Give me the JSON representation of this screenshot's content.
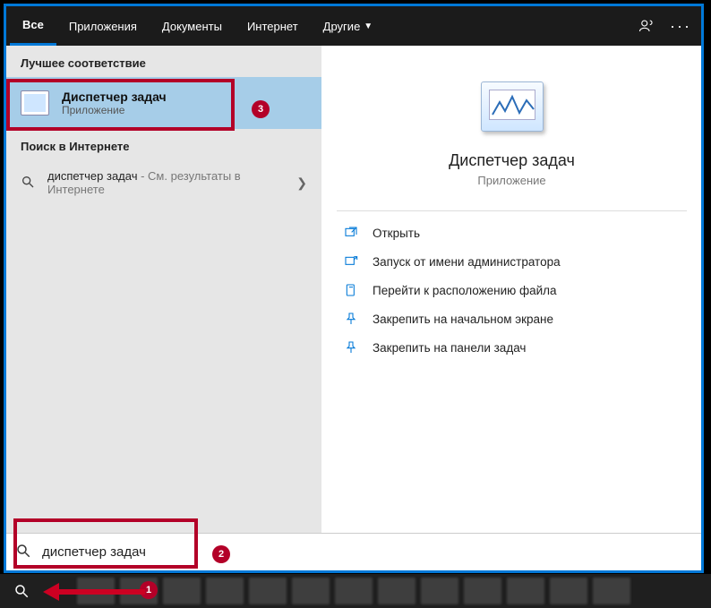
{
  "tabs": {
    "all": "Все",
    "apps": "Приложения",
    "docs": "Документы",
    "web": "Интернет",
    "other": "Другие"
  },
  "left": {
    "best_match": "Лучшее соответствие",
    "result_title": "Диспетчер задач",
    "result_sub": "Приложение",
    "web_section": "Поиск в Интернете",
    "web_query": "диспетчер задач",
    "web_suffix": " - См. результаты в Интернете"
  },
  "preview": {
    "title": "Диспетчер задач",
    "sub": "Приложение",
    "actions": {
      "open": "Открыть",
      "admin": "Запуск от имени администратора",
      "location": "Перейти к расположению файла",
      "pin_start": "Закрепить на начальном экране",
      "pin_taskbar": "Закрепить на панели задач"
    }
  },
  "search": {
    "value": "диспетчер задач"
  },
  "badges": {
    "b1": "1",
    "b2": "2",
    "b3": "3"
  }
}
